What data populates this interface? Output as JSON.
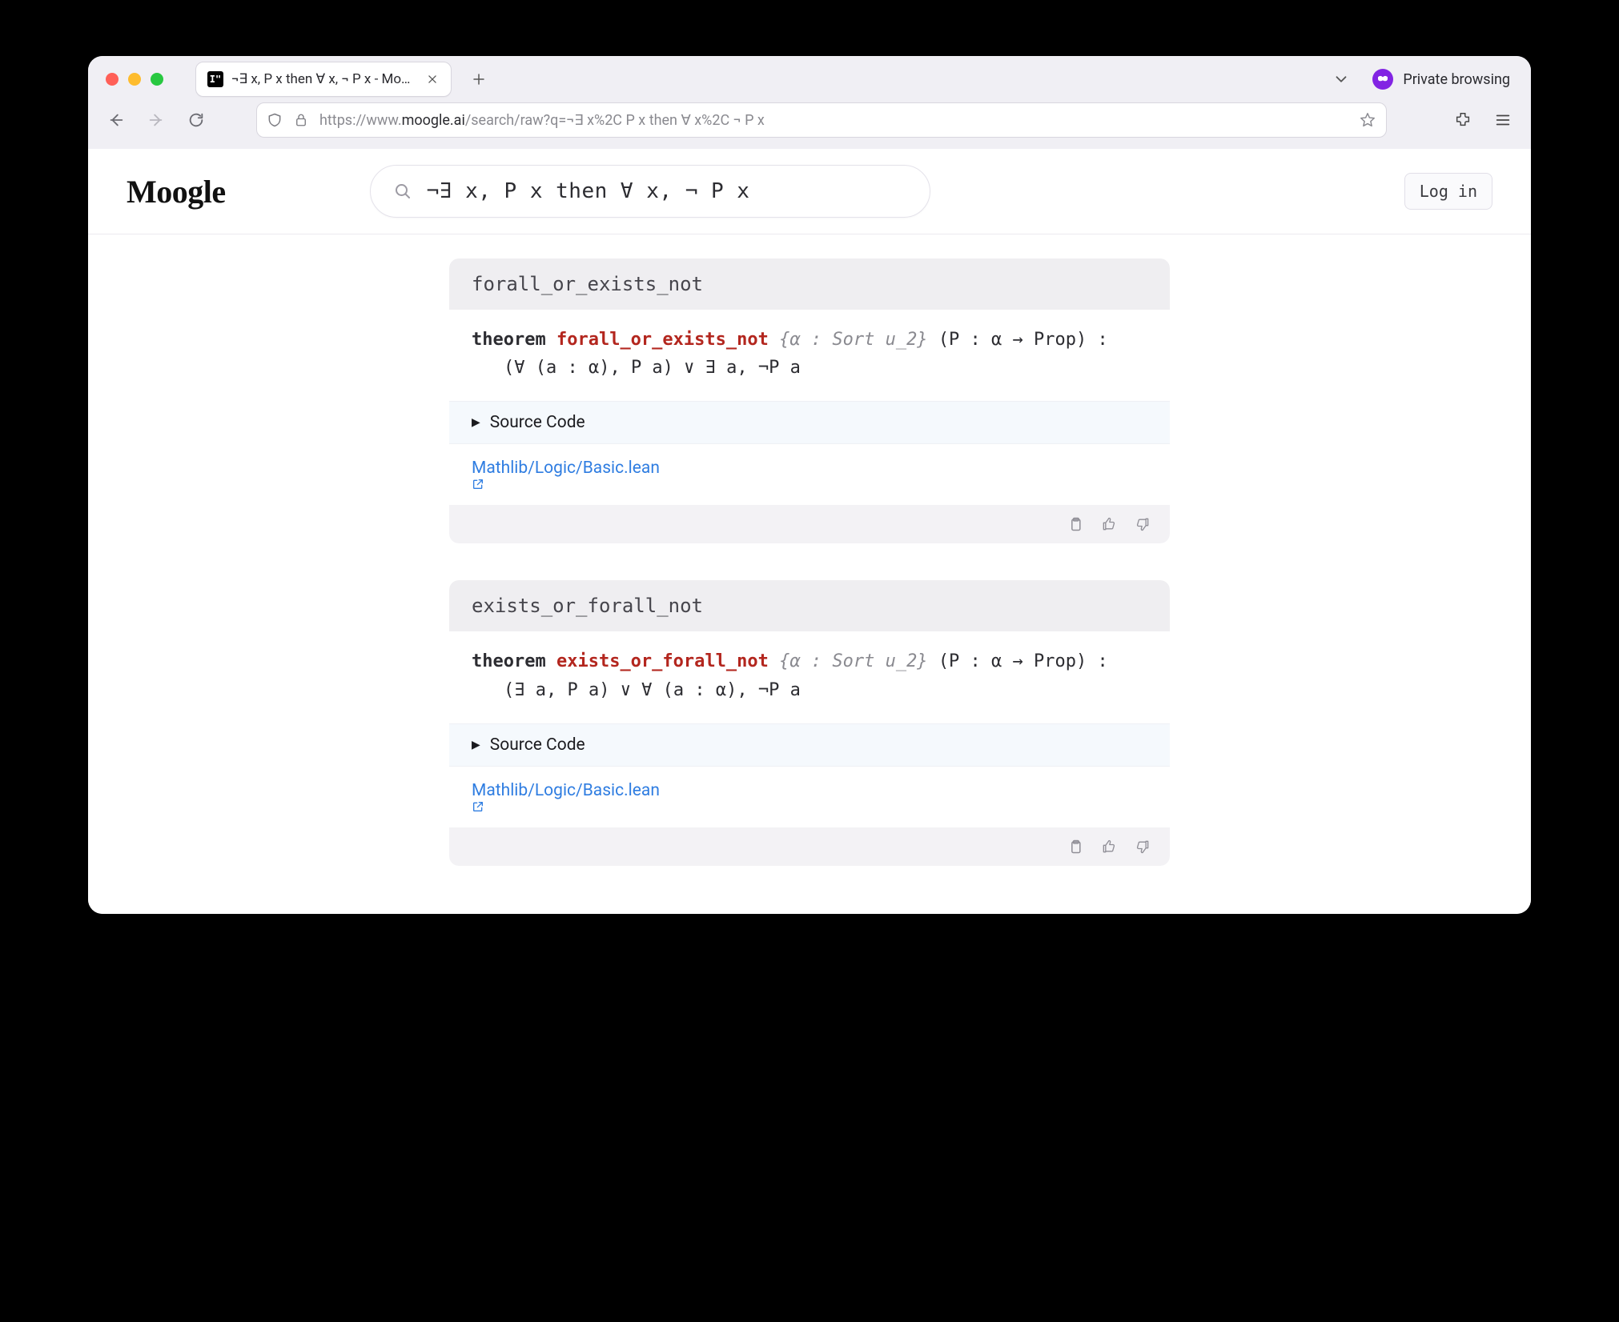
{
  "browser": {
    "tab_title": "¬∃ x, P x then ∀ x, ¬ P x - Moogl…",
    "favicon_text": "I\"",
    "private_label": "Private browsing",
    "url_prefix": "https://www.",
    "url_host": "moogle.ai",
    "url_path": "/search/raw?q=¬∃ x%2C P x then ∀ x%2C ¬ P x"
  },
  "site": {
    "logo": "Moogle",
    "search_value": "¬∃ x, P x then ∀ x, ¬ P x",
    "login": "Log in"
  },
  "results": [
    {
      "name": "forall_or_exists_not",
      "keyword": "theorem",
      "theorem_name": "forall_or_exists_not",
      "implicit": "{α : Sort u_2}",
      "explicit": "(P : α → Prop) :",
      "body": "(∀ (a : α), P a) ∨ ∃ a, ¬P a",
      "source_label": "Source Code",
      "file": "Mathlib/Logic/Basic.lean"
    },
    {
      "name": "exists_or_forall_not",
      "keyword": "theorem",
      "theorem_name": "exists_or_forall_not",
      "implicit": "{α : Sort u_2}",
      "explicit": "(P : α → Prop) :",
      "body": "(∃ a, P a) ∨ ∀ (a : α), ¬P a",
      "source_label": "Source Code",
      "file": "Mathlib/Logic/Basic.lean"
    }
  ]
}
